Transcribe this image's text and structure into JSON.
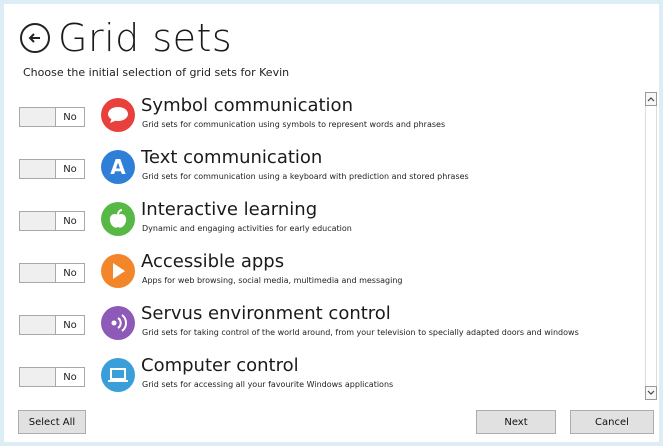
{
  "header": {
    "title": "Grid sets",
    "subtitle": "Choose the initial selection of grid sets for Kevin"
  },
  "items": [
    {
      "title": "Symbol communication",
      "desc": "Grid sets for communication using symbols to represent words and phrases",
      "state": "No",
      "icon": "speech-bubble-icon",
      "color": "#e8413c"
    },
    {
      "title": "Text communication",
      "desc": "Grid sets for communication using a keyboard with prediction and stored phrases",
      "state": "No",
      "icon": "letter-a-icon",
      "color": "#2f7fd8",
      "glyph": "A"
    },
    {
      "title": "Interactive learning",
      "desc": "Dynamic and engaging activities for early education",
      "state": "No",
      "icon": "apple-icon",
      "color": "#57b846"
    },
    {
      "title": "Accessible apps",
      "desc": "Apps for web browsing, social media, multimedia and messaging",
      "state": "No",
      "icon": "play-icon",
      "color": "#f3862b"
    },
    {
      "title": "Servus environment control",
      "desc": "Grid sets for taking control of the world around, from your television to specially adapted doors and windows",
      "state": "No",
      "icon": "signal-icon",
      "color": "#8d5ab7"
    },
    {
      "title": "Computer control",
      "desc": "Grid sets for accessing all your favourite Windows applications",
      "state": "No",
      "icon": "laptop-icon",
      "color": "#3a9ed8"
    }
  ],
  "buttons": {
    "select_all": "Select All",
    "next": "Next",
    "cancel": "Cancel"
  }
}
